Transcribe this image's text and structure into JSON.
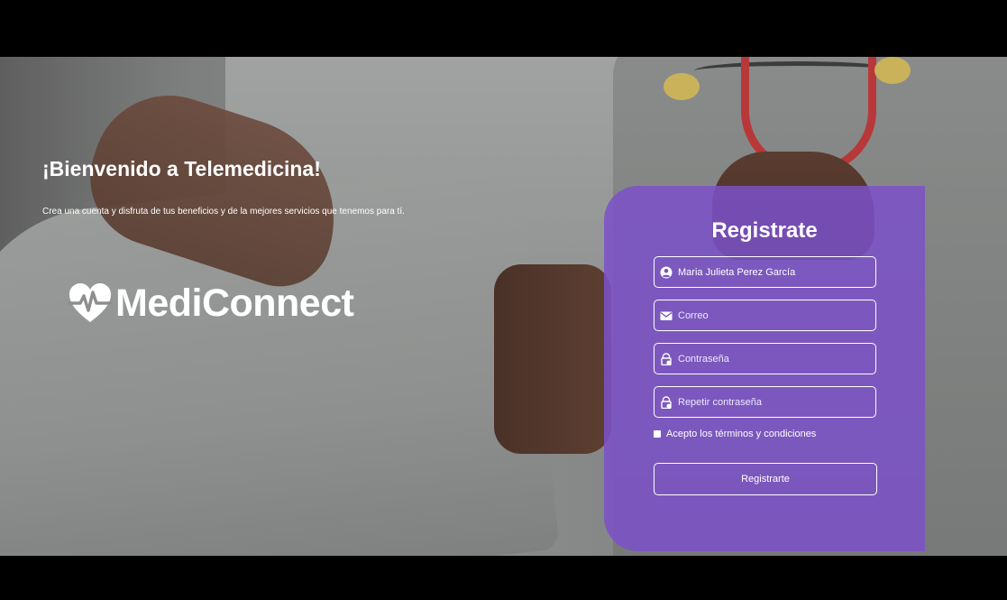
{
  "hero": {
    "title": "¡Bienvenido a Telemedicina!",
    "subtitle": "Crea una cuenta y disfruta de tus beneficios y de la mejores servicios que tenemos para tí."
  },
  "brand": {
    "name": "MediConnect",
    "icon": "heart-pulse-icon"
  },
  "register": {
    "title": "Registrate",
    "name_field": {
      "value": "Maria Julieta Perez García",
      "icon": "user-circle-icon"
    },
    "email_field": {
      "value": "",
      "placeholder": "Correo",
      "icon": "envelope-icon"
    },
    "password_field": {
      "value": "",
      "placeholder": "Contraseña",
      "icon": "lock-icon"
    },
    "repeat_password_field": {
      "value": "",
      "placeholder": "Repetir contraseña",
      "icon": "lock-icon"
    },
    "terms_label": "Acepto los términos y condiciones",
    "submit_label": "Registrarte"
  },
  "colors": {
    "card": "#7c52c8",
    "text": "#ffffff"
  }
}
